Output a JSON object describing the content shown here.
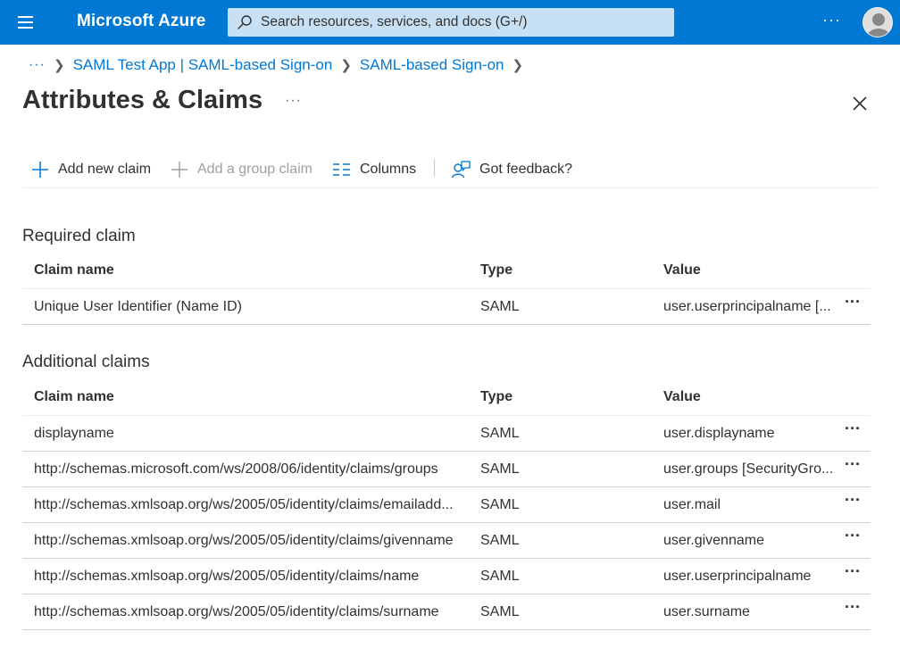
{
  "topbar": {
    "brand": "Microsoft Azure",
    "search_placeholder": "Search resources, services, and docs (G+/)",
    "more": "···"
  },
  "breadcrumb": {
    "more": "···",
    "items": [
      "SAML Test App | SAML-based Sign-on",
      "SAML-based Sign-on"
    ]
  },
  "page": {
    "title": "Attributes & Claims",
    "more": "···"
  },
  "toolbar": {
    "add_new_claim": "Add new claim",
    "add_group_claim": "Add a group claim",
    "columns": "Columns",
    "feedback": "Got feedback?"
  },
  "required": {
    "title": "Required claim",
    "columns": [
      "Claim name",
      "Type",
      "Value"
    ],
    "rows": [
      {
        "name": "Unique User Identifier (Name ID)",
        "type": "SAML",
        "value": "user.userprincipalname [..."
      }
    ]
  },
  "additional": {
    "title": "Additional claims",
    "columns": [
      "Claim name",
      "Type",
      "Value"
    ],
    "rows": [
      {
        "name": "displayname",
        "type": "SAML",
        "value": "user.displayname"
      },
      {
        "name": "http://schemas.microsoft.com/ws/2008/06/identity/claims/groups",
        "type": "SAML",
        "value": "user.groups [SecurityGro..."
      },
      {
        "name": "http://schemas.xmlsoap.org/ws/2005/05/identity/claims/emailadd...",
        "type": "SAML",
        "value": "user.mail"
      },
      {
        "name": "http://schemas.xmlsoap.org/ws/2005/05/identity/claims/givenname",
        "type": "SAML",
        "value": "user.givenname"
      },
      {
        "name": "http://schemas.xmlsoap.org/ws/2005/05/identity/claims/name",
        "type": "SAML",
        "value": "user.userprincipalname"
      },
      {
        "name": "http://schemas.xmlsoap.org/ws/2005/05/identity/claims/surname",
        "type": "SAML",
        "value": "user.surname"
      }
    ]
  },
  "row_more": "···",
  "colors": {
    "brand_blue": "#0078d4",
    "search_bg": "#c7e0f4",
    "text": "#323130",
    "disabled": "#a19f9d"
  },
  "icons": {
    "menu": "hamburger-icon",
    "search": "search-icon",
    "close": "close-icon",
    "add": "plus-icon",
    "columns": "columns-icon",
    "feedback": "feedback-icon",
    "avatar": "avatar-icon"
  }
}
